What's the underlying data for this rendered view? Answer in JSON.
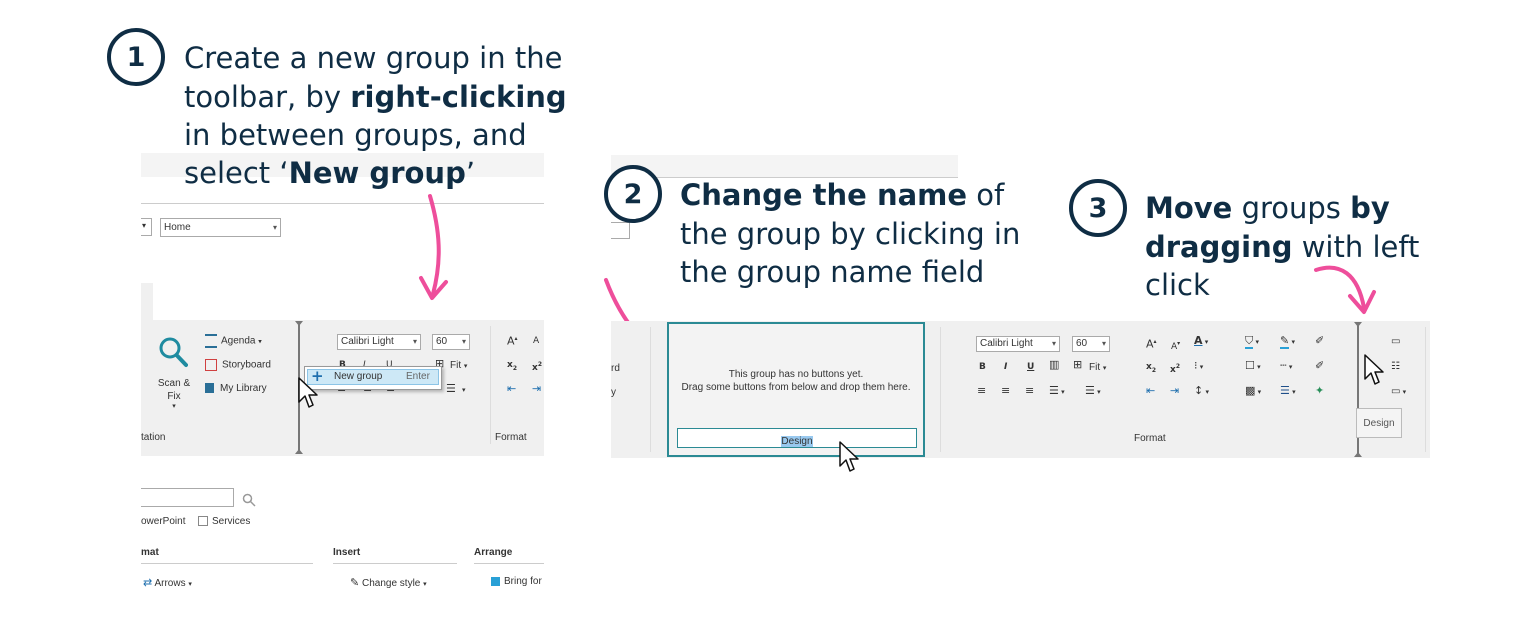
{
  "steps": [
    {
      "number": "1",
      "line1": "Create a new group in the",
      "line2_pre": "toolbar, by ",
      "line2_bold": "right-clicking",
      "line3": "in between groups, and",
      "line4_pre": "select ‘",
      "line4_bold": "New group",
      "line4_post": "’"
    },
    {
      "number": "2",
      "line1_bold": "Change the name",
      "line1_post": " of",
      "line2": "the group by clicking in",
      "line3": "the group name field"
    },
    {
      "number": "3",
      "line1_bold": "Move",
      "line1_mid": " groups ",
      "line1_bold2": "by",
      "line2_bold": "dragging",
      "line2_post": " with left",
      "line3": "click"
    }
  ],
  "panel1": {
    "home_dropdown": "Home",
    "agenda": "Agenda",
    "storyboard": "Storyboard",
    "my_library": "My Library",
    "scan_fix_1": "Scan &",
    "scan_fix_2": "Fix",
    "group_label_left": "tation",
    "group_label_format": "Format",
    "font_name": "Calibri Light",
    "font_size": "60",
    "fit_label": "Fit",
    "context_menu": {
      "item": "New group",
      "shortcut": "Enter"
    },
    "search_placeholder": "",
    "filter_powerpoint": "owerPoint",
    "filter_services": "Services",
    "cat_mat": "mat",
    "cat_insert": "Insert",
    "cat_arrange": "Arrange",
    "btn_arrows": "Arrows",
    "btn_change_style": "Change style",
    "btn_bring": "Bring for"
  },
  "panel2": {
    "frag_1": "rd",
    "frag_2": "y",
    "empty_line1": "This group has no buttons yet.",
    "empty_line2": "Drag some buttons from below and drop them here.",
    "name_field_value": "Design",
    "font_name": "Calibri Light",
    "font_size": "60",
    "fit_label": "Fit",
    "format_label": "Format",
    "design_group_label": "Design"
  },
  "colors": {
    "navy": "#0f2d44",
    "pink": "#ee4e9b",
    "teal": "#2b8a94",
    "ribbon": "#f0f0f0",
    "selection": "#99c9ef"
  }
}
